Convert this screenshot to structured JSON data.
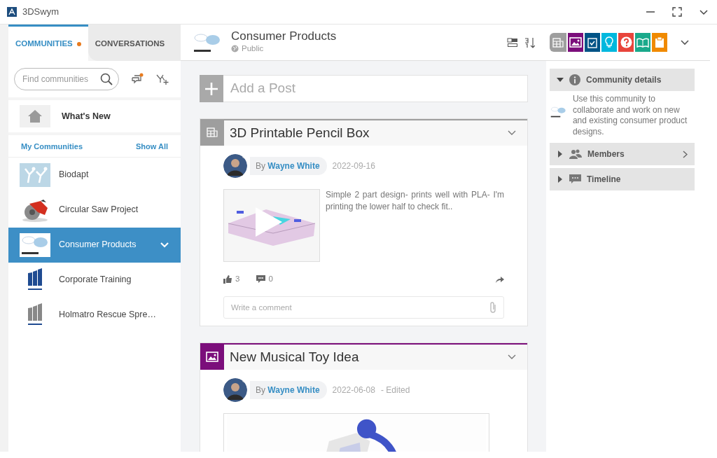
{
  "app": {
    "title": "3DSwym"
  },
  "sidebar": {
    "tabs": [
      {
        "label": "COMMUNITIES",
        "selected": true,
        "notification": true
      },
      {
        "label": "CONVERSATIONS",
        "selected": false,
        "notification": false
      }
    ],
    "search": {
      "placeholder": "Find communities"
    },
    "whats_new": {
      "label": "What's New"
    },
    "section": {
      "title": "My Communities",
      "action": "Show All"
    },
    "communities": [
      {
        "name": "Biodapt",
        "kind": "figures",
        "selected": false
      },
      {
        "name": "Circular Saw Project",
        "kind": "saw",
        "selected": false
      },
      {
        "name": "Consumer Products",
        "kind": "mouse",
        "selected": true
      },
      {
        "name": "Corporate Training",
        "kind": "bars-blue",
        "selected": false
      },
      {
        "name": "Holmatro Rescue Spre…",
        "kind": "bars-grey",
        "selected": false
      }
    ]
  },
  "header": {
    "title": "Consumer Products",
    "visibility": "Public"
  },
  "apps": [
    {
      "kind": "post",
      "color": "#9e9e9e",
      "selected": true
    },
    {
      "kind": "media",
      "color": "#7b0e7b",
      "selected": false
    },
    {
      "kind": "survey",
      "color": "#005386",
      "selected": false
    },
    {
      "kind": "idea",
      "color": "#00b8de",
      "selected": false
    },
    {
      "kind": "question",
      "color": "#e8453c",
      "selected": false
    },
    {
      "kind": "wiki",
      "color": "#1aa98b",
      "selected": false
    },
    {
      "kind": "clipboard",
      "color": "#f08a00",
      "selected": false
    }
  ],
  "feed": {
    "add_post": {
      "placeholder": "Add a Post"
    },
    "posts": [
      {
        "title": "3D Printable Pencil Box",
        "kind": "post",
        "color": "#9e9e9e",
        "author_prefix": "By",
        "author": "Wayne White",
        "date": "2022-09-16",
        "text": "Simple 2 part design- prints well with PLA- I'm printing the lower half to check fit..",
        "media": {
          "kind": "picture",
          "video": true
        },
        "likes": "3",
        "comments": "0",
        "comment": {
          "placeholder": "Write a comment"
        }
      },
      {
        "title": "New Musical Toy Idea",
        "kind": "media",
        "color": "#7b0e7b",
        "author_prefix": "By",
        "author": "Wayne White",
        "date": "2022-06-08",
        "edited": "- Edited",
        "media": {
          "kind": "picture"
        }
      }
    ]
  },
  "details": {
    "sections": [
      {
        "title": "Community details",
        "kind": "info",
        "expanded": true,
        "description": "Use this community to collaborate and work on new and existing consumer product designs."
      },
      {
        "title": "Members",
        "kind": "members",
        "expanded": false,
        "link": true
      },
      {
        "title": "Timeline",
        "kind": "timeline",
        "expanded": false
      }
    ]
  }
}
